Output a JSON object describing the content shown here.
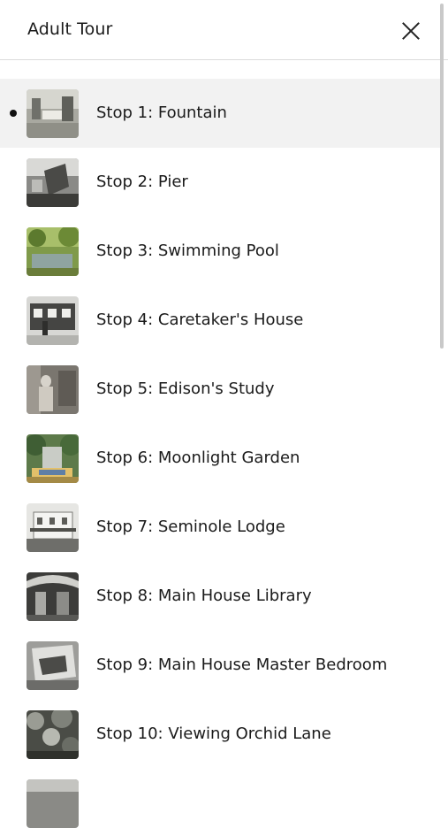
{
  "header": {
    "title": "Adult Tour"
  },
  "stops": [
    {
      "label": "Stop 1: Fountain",
      "thumb": "fountain",
      "active": true
    },
    {
      "label": "Stop 2: Pier",
      "thumb": "pier"
    },
    {
      "label": "Stop 3: Swimming Pool",
      "thumb": "pool"
    },
    {
      "label": "Stop 4: Caretaker's House",
      "thumb": "caretaker"
    },
    {
      "label": "Stop 5: Edison's Study",
      "thumb": "study"
    },
    {
      "label": "Stop 6: Moonlight Garden",
      "thumb": "garden"
    },
    {
      "label": "Stop 7: Seminole Lodge",
      "thumb": "lodge"
    },
    {
      "label": "Stop 8: Main House Library",
      "thumb": "library"
    },
    {
      "label": "Stop 9: Main House Master Bedroom",
      "thumb": "bedroom"
    },
    {
      "label": "Stop 10: Viewing Orchid Lane",
      "thumb": "orchid"
    }
  ]
}
